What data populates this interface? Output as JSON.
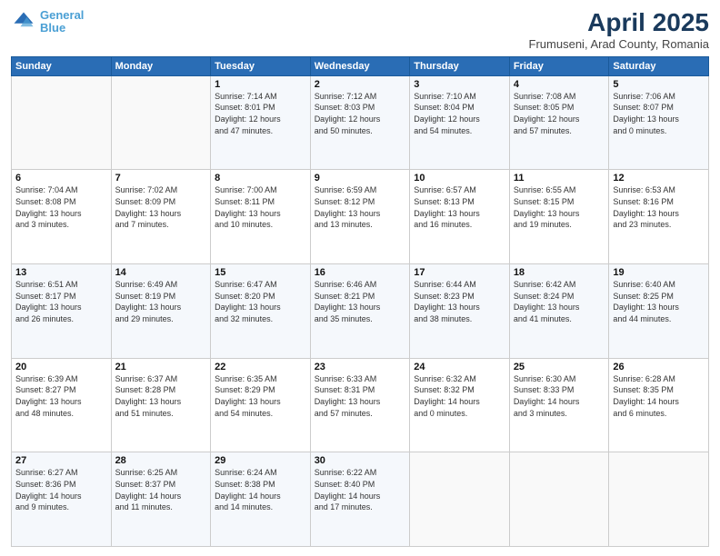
{
  "logo": {
    "line1": "General",
    "line2": "Blue"
  },
  "title": "April 2025",
  "subtitle": "Frumuseni, Arad County, Romania",
  "header_days": [
    "Sunday",
    "Monday",
    "Tuesday",
    "Wednesday",
    "Thursday",
    "Friday",
    "Saturday"
  ],
  "weeks": [
    [
      {
        "day": "",
        "detail": ""
      },
      {
        "day": "",
        "detail": ""
      },
      {
        "day": "1",
        "detail": "Sunrise: 7:14 AM\nSunset: 8:01 PM\nDaylight: 12 hours\nand 47 minutes."
      },
      {
        "day": "2",
        "detail": "Sunrise: 7:12 AM\nSunset: 8:03 PM\nDaylight: 12 hours\nand 50 minutes."
      },
      {
        "day": "3",
        "detail": "Sunrise: 7:10 AM\nSunset: 8:04 PM\nDaylight: 12 hours\nand 54 minutes."
      },
      {
        "day": "4",
        "detail": "Sunrise: 7:08 AM\nSunset: 8:05 PM\nDaylight: 12 hours\nand 57 minutes."
      },
      {
        "day": "5",
        "detail": "Sunrise: 7:06 AM\nSunset: 8:07 PM\nDaylight: 13 hours\nand 0 minutes."
      }
    ],
    [
      {
        "day": "6",
        "detail": "Sunrise: 7:04 AM\nSunset: 8:08 PM\nDaylight: 13 hours\nand 3 minutes."
      },
      {
        "day": "7",
        "detail": "Sunrise: 7:02 AM\nSunset: 8:09 PM\nDaylight: 13 hours\nand 7 minutes."
      },
      {
        "day": "8",
        "detail": "Sunrise: 7:00 AM\nSunset: 8:11 PM\nDaylight: 13 hours\nand 10 minutes."
      },
      {
        "day": "9",
        "detail": "Sunrise: 6:59 AM\nSunset: 8:12 PM\nDaylight: 13 hours\nand 13 minutes."
      },
      {
        "day": "10",
        "detail": "Sunrise: 6:57 AM\nSunset: 8:13 PM\nDaylight: 13 hours\nand 16 minutes."
      },
      {
        "day": "11",
        "detail": "Sunrise: 6:55 AM\nSunset: 8:15 PM\nDaylight: 13 hours\nand 19 minutes."
      },
      {
        "day": "12",
        "detail": "Sunrise: 6:53 AM\nSunset: 8:16 PM\nDaylight: 13 hours\nand 23 minutes."
      }
    ],
    [
      {
        "day": "13",
        "detail": "Sunrise: 6:51 AM\nSunset: 8:17 PM\nDaylight: 13 hours\nand 26 minutes."
      },
      {
        "day": "14",
        "detail": "Sunrise: 6:49 AM\nSunset: 8:19 PM\nDaylight: 13 hours\nand 29 minutes."
      },
      {
        "day": "15",
        "detail": "Sunrise: 6:47 AM\nSunset: 8:20 PM\nDaylight: 13 hours\nand 32 minutes."
      },
      {
        "day": "16",
        "detail": "Sunrise: 6:46 AM\nSunset: 8:21 PM\nDaylight: 13 hours\nand 35 minutes."
      },
      {
        "day": "17",
        "detail": "Sunrise: 6:44 AM\nSunset: 8:23 PM\nDaylight: 13 hours\nand 38 minutes."
      },
      {
        "day": "18",
        "detail": "Sunrise: 6:42 AM\nSunset: 8:24 PM\nDaylight: 13 hours\nand 41 minutes."
      },
      {
        "day": "19",
        "detail": "Sunrise: 6:40 AM\nSunset: 8:25 PM\nDaylight: 13 hours\nand 44 minutes."
      }
    ],
    [
      {
        "day": "20",
        "detail": "Sunrise: 6:39 AM\nSunset: 8:27 PM\nDaylight: 13 hours\nand 48 minutes."
      },
      {
        "day": "21",
        "detail": "Sunrise: 6:37 AM\nSunset: 8:28 PM\nDaylight: 13 hours\nand 51 minutes."
      },
      {
        "day": "22",
        "detail": "Sunrise: 6:35 AM\nSunset: 8:29 PM\nDaylight: 13 hours\nand 54 minutes."
      },
      {
        "day": "23",
        "detail": "Sunrise: 6:33 AM\nSunset: 8:31 PM\nDaylight: 13 hours\nand 57 minutes."
      },
      {
        "day": "24",
        "detail": "Sunrise: 6:32 AM\nSunset: 8:32 PM\nDaylight: 14 hours\nand 0 minutes."
      },
      {
        "day": "25",
        "detail": "Sunrise: 6:30 AM\nSunset: 8:33 PM\nDaylight: 14 hours\nand 3 minutes."
      },
      {
        "day": "26",
        "detail": "Sunrise: 6:28 AM\nSunset: 8:35 PM\nDaylight: 14 hours\nand 6 minutes."
      }
    ],
    [
      {
        "day": "27",
        "detail": "Sunrise: 6:27 AM\nSunset: 8:36 PM\nDaylight: 14 hours\nand 9 minutes."
      },
      {
        "day": "28",
        "detail": "Sunrise: 6:25 AM\nSunset: 8:37 PM\nDaylight: 14 hours\nand 11 minutes."
      },
      {
        "day": "29",
        "detail": "Sunrise: 6:24 AM\nSunset: 8:38 PM\nDaylight: 14 hours\nand 14 minutes."
      },
      {
        "day": "30",
        "detail": "Sunrise: 6:22 AM\nSunset: 8:40 PM\nDaylight: 14 hours\nand 17 minutes."
      },
      {
        "day": "",
        "detail": ""
      },
      {
        "day": "",
        "detail": ""
      },
      {
        "day": "",
        "detail": ""
      }
    ]
  ]
}
